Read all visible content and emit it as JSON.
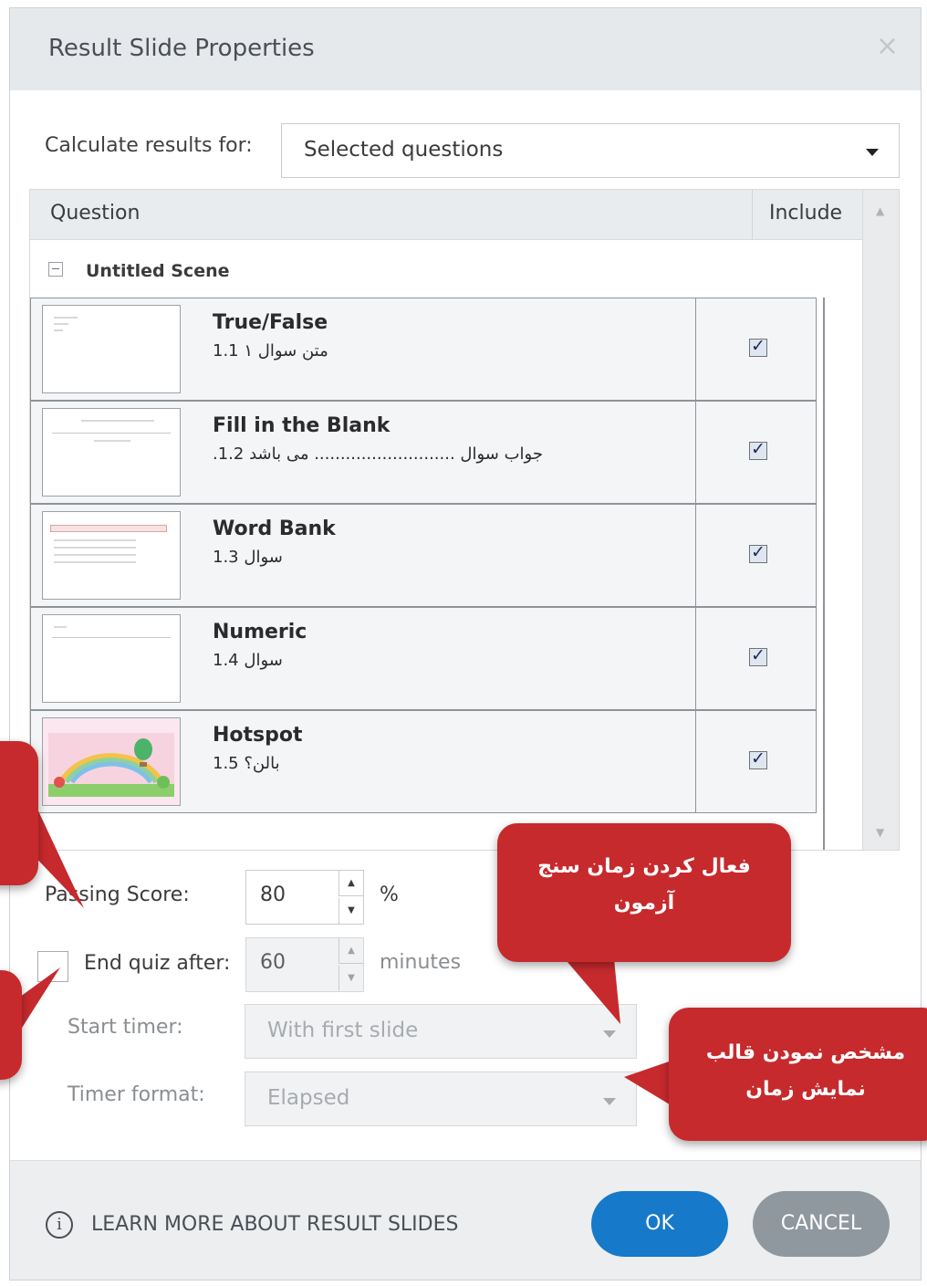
{
  "dialog": {
    "title": "Result Slide Properties",
    "close_glyph": "×"
  },
  "calculate": {
    "label": "Calculate results for:",
    "value": "Selected questions"
  },
  "table": {
    "header_question": "Question",
    "header_include": "Include",
    "scene_label": "Untitled Scene",
    "rows": [
      {
        "title": "True/False",
        "subtitle": "متن سوال ۱ 1.1",
        "included": true
      },
      {
        "title": "Fill in the Blank",
        "subtitle": ".جواب سوال ........................... می باشد 1.2",
        "included": true
      },
      {
        "title": "Word Bank",
        "subtitle": "سوال 1.3",
        "included": true
      },
      {
        "title": "Numeric",
        "subtitle": "سوال 1.4",
        "included": true
      },
      {
        "title": "Hotspot",
        "subtitle": "بالن؟ 1.5",
        "included": true
      }
    ]
  },
  "passing": {
    "label": "Passing Score:",
    "value": "80",
    "unit": "%"
  },
  "end_quiz": {
    "label": "End quiz after:",
    "value": "60",
    "unit": "minutes",
    "checked": false
  },
  "start_timer": {
    "label": "Start timer:",
    "value": "With first slide"
  },
  "timer_format": {
    "label": "Timer format:",
    "value": "Elapsed"
  },
  "footer": {
    "learn_more": "LEARN MORE ABOUT RESULT SLIDES",
    "ok_label": "OK",
    "cancel_label": "CANCEL",
    "info_glyph": "i"
  },
  "callouts": {
    "enable_timer": {
      "line1": "فعال کردن زمان سنج",
      "line2": "آزمون"
    },
    "timer_format": {
      "line1": "مشخص نمودن قالب",
      "line2": "نمایش زمان"
    }
  },
  "colors": {
    "accent": "#1679c9",
    "callout": "#c62a2d",
    "cancel": "#8f989f",
    "titlebar": "#e6e9ec"
  }
}
